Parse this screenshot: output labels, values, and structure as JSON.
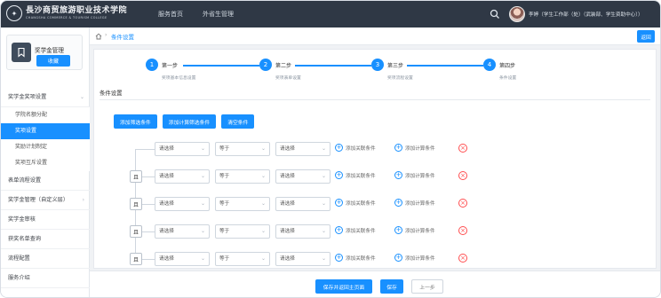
{
  "header": {
    "logo_main": "長沙商贸旅游职业技术学院",
    "logo_sub": "CHANGSHA COMMERCE & TOURISM COLLEGE",
    "nav": [
      "服务首页",
      "外省生管理"
    ],
    "user_text": "李婷（学生工作部（处）（武装部、学生资助中心））"
  },
  "sidebar": {
    "card_title": "奖学金管理",
    "card_button": "收藏",
    "menu": [
      {
        "label": "奖学金奖项设置",
        "type": "group",
        "arrow": "⌄"
      },
      {
        "label": "学院名额分配",
        "type": "sub"
      },
      {
        "label": "奖项设置",
        "type": "sub",
        "active": true
      },
      {
        "label": "奖励计划制定",
        "type": "sub"
      },
      {
        "label": "奖项互斥设置",
        "type": "sub"
      },
      {
        "label": "表单流程设置",
        "type": "group"
      },
      {
        "label": "奖学金管理（自定义层）",
        "type": "group",
        "arrow": "›"
      },
      {
        "label": "奖学金审核",
        "type": "group"
      },
      {
        "label": "获奖名单查询",
        "type": "group"
      },
      {
        "label": "流程配置",
        "type": "group"
      },
      {
        "label": "服务介绍",
        "type": "group"
      }
    ]
  },
  "breadcrumb": {
    "sep": "›",
    "current": "条件设置",
    "back": "返回"
  },
  "steps": [
    {
      "num": "1",
      "title": "第一步",
      "desc": "奖项基本信息设置"
    },
    {
      "num": "2",
      "title": "第二步",
      "desc": "奖项表单设置"
    },
    {
      "num": "3",
      "title": "第三步",
      "desc": "奖项流程设置"
    },
    {
      "num": "4",
      "title": "第四步",
      "desc": "条件设置"
    }
  ],
  "section_title": "条件设置",
  "actions": [
    "添加筛选条件",
    "添加计算筛选条件",
    "清空条件"
  ],
  "rows": [
    {
      "and": "",
      "field": "请选择",
      "op": "等于",
      "value": "请选择"
    },
    {
      "and": "且",
      "field": "请选择",
      "op": "等于",
      "value": "请选择"
    },
    {
      "and": "且",
      "field": "请选择",
      "op": "等于",
      "value": "请选择"
    },
    {
      "and": "且",
      "field": "请选择",
      "op": "等于",
      "value": "请选择"
    },
    {
      "and": "且",
      "field": "请选择",
      "op": "等于",
      "value": "请选择"
    }
  ],
  "row_links": {
    "add_related": "添加关联条件",
    "add_calc": "添加计算条件"
  },
  "footer": {
    "save_return": "保存并返回主页面",
    "save": "保存",
    "prev": "上一步"
  },
  "colors": {
    "accent": "#1890ff",
    "header_bg": "#2f3845",
    "delete": "#ff4d4f"
  }
}
